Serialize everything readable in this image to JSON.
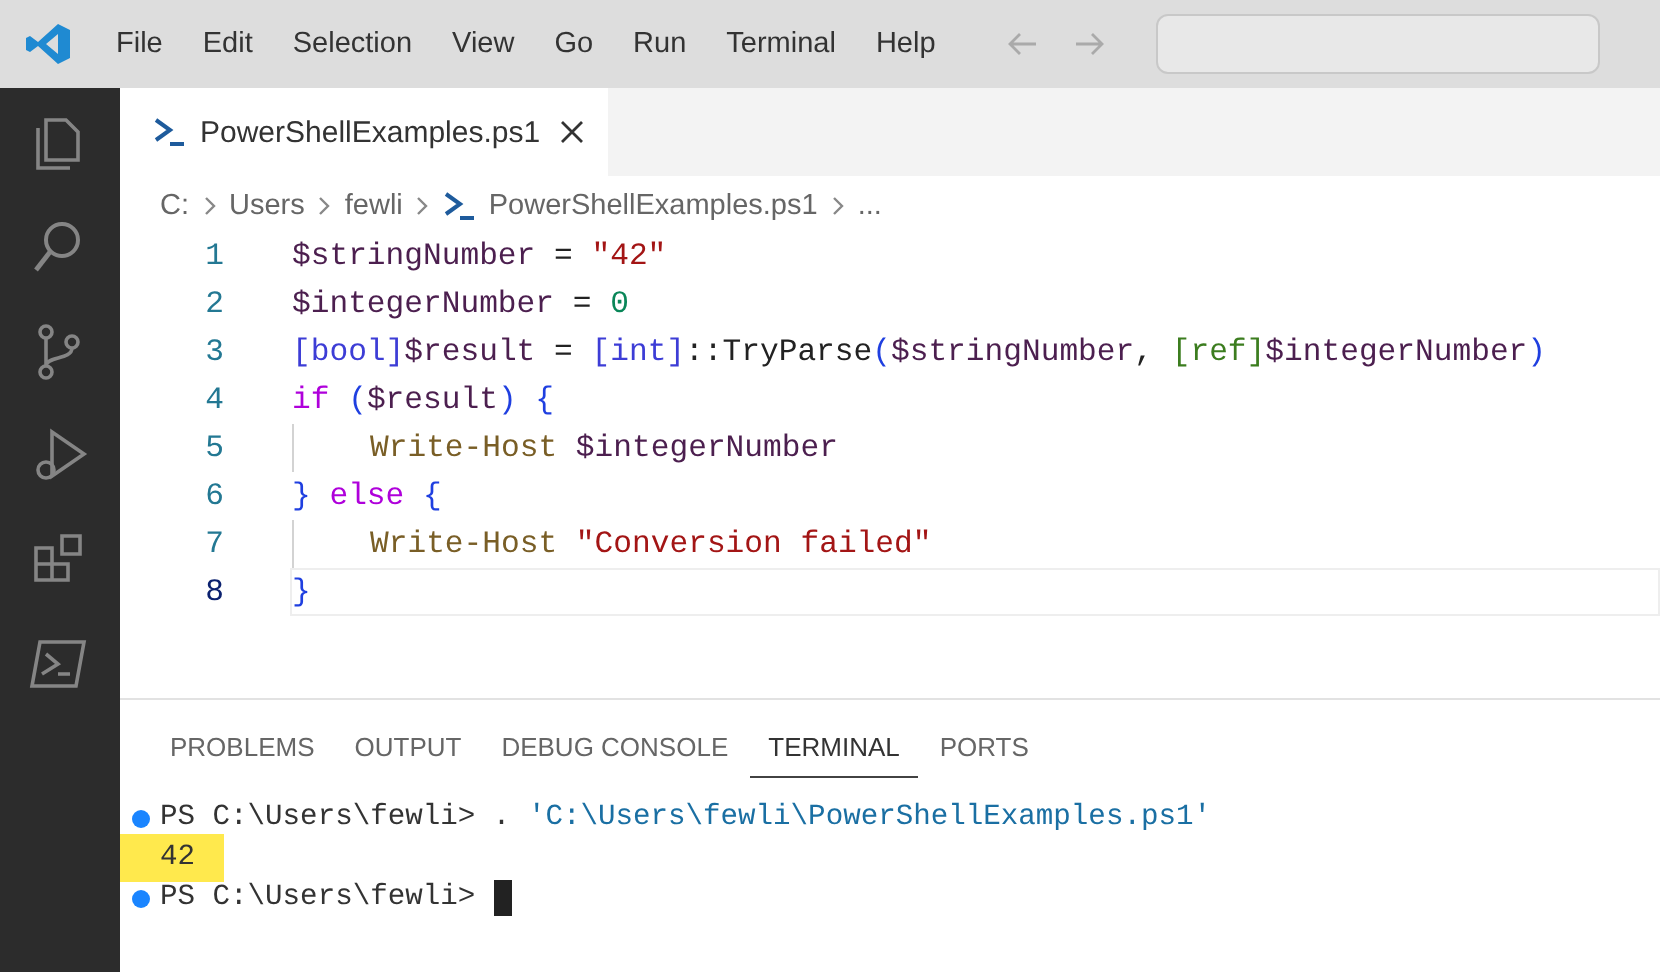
{
  "menu": [
    "File",
    "Edit",
    "Selection",
    "View",
    "Go",
    "Run",
    "Terminal",
    "Help"
  ],
  "nav": {
    "back_disabled": true,
    "forward_disabled": true
  },
  "activity_bar": [
    {
      "kind": "files",
      "selected": false
    },
    {
      "kind": "search",
      "selected": false
    },
    {
      "kind": "source-control",
      "selected": false
    },
    {
      "kind": "run-debug",
      "selected": false
    },
    {
      "kind": "extensions",
      "selected": false
    },
    {
      "kind": "powershell",
      "selected": false
    }
  ],
  "editor_tabs": [
    {
      "label": "PowerShellExamples.ps1",
      "selected": true
    }
  ],
  "breadcrumbs": [
    {
      "kind": "folder",
      "text": "C:"
    },
    {
      "kind": "folder",
      "text": "Users"
    },
    {
      "kind": "folder",
      "text": "fewli"
    },
    {
      "kind": "file",
      "text": "PowerShellExamples.ps1"
    },
    {
      "kind": "more",
      "text": "..."
    }
  ],
  "code_lines": [
    {
      "number": "1",
      "indented": false,
      "current": false,
      "tokens": [
        {
          "kind": "var",
          "text": "$stringNumber"
        },
        {
          "kind": "op",
          "text": " = "
        },
        {
          "kind": "str",
          "text": "\"42\""
        }
      ]
    },
    {
      "number": "2",
      "indented": false,
      "current": false,
      "tokens": [
        {
          "kind": "var",
          "text": "$integerNumber"
        },
        {
          "kind": "op",
          "text": " = "
        },
        {
          "kind": "num",
          "text": "0"
        }
      ]
    },
    {
      "number": "3",
      "indented": false,
      "current": false,
      "tokens": [
        {
          "kind": "type",
          "text": "[bool]"
        },
        {
          "kind": "var",
          "text": "$result"
        },
        {
          "kind": "op",
          "text": " = "
        },
        {
          "kind": "type",
          "text": "[int]"
        },
        {
          "kind": "op",
          "text": "::TryParse"
        },
        {
          "kind": "paren",
          "text": "("
        },
        {
          "kind": "var",
          "text": "$stringNumber"
        },
        {
          "kind": "op",
          "text": ", "
        },
        {
          "kind": "type2",
          "text": "[ref]"
        },
        {
          "kind": "var",
          "text": "$integerNumber"
        },
        {
          "kind": "paren",
          "text": ")"
        }
      ]
    },
    {
      "number": "4",
      "indented": false,
      "current": false,
      "tokens": [
        {
          "kind": "kw",
          "text": "if"
        },
        {
          "kind": "paren",
          "text": " ("
        },
        {
          "kind": "var",
          "text": "$result"
        },
        {
          "kind": "paren",
          "text": ")"
        },
        {
          "kind": "paren",
          "text": " {"
        }
      ]
    },
    {
      "number": "5",
      "indented": true,
      "current": false,
      "tokens": [
        {
          "kind": "cmd",
          "text": "Write-Host"
        },
        {
          "kind": "var",
          "text": " $integerNumber"
        }
      ]
    },
    {
      "number": "6",
      "indented": false,
      "current": false,
      "tokens": [
        {
          "kind": "paren",
          "text": "}"
        },
        {
          "kind": "kw",
          "text": " else"
        },
        {
          "kind": "paren",
          "text": " {"
        }
      ]
    },
    {
      "number": "7",
      "indented": true,
      "current": false,
      "tokens": [
        {
          "kind": "cmd",
          "text": "Write-Host"
        },
        {
          "kind": "str",
          "text": " \"Conversion failed\""
        }
      ]
    },
    {
      "number": "8",
      "indented": false,
      "current": true,
      "tokens": [
        {
          "kind": "paren",
          "text": "}"
        }
      ]
    }
  ],
  "panel_tabs": [
    {
      "label": "PROBLEMS",
      "selected": false
    },
    {
      "label": "OUTPUT",
      "selected": false
    },
    {
      "label": "DEBUG CONSOLE",
      "selected": false
    },
    {
      "label": "TERMINAL",
      "selected": true
    },
    {
      "label": "PORTS",
      "selected": false
    }
  ],
  "terminal": [
    {
      "kind": "command",
      "prompt": "PS C:\\Users\\fewli>",
      "command": ".",
      "argument": "'C:\\Users\\fewli\\PowerShellExamples.ps1'"
    },
    {
      "kind": "output",
      "text": "42",
      "highlighted": true
    },
    {
      "kind": "prompt",
      "prompt": "PS C:\\Users\\fewli>",
      "cursor": true
    }
  ]
}
